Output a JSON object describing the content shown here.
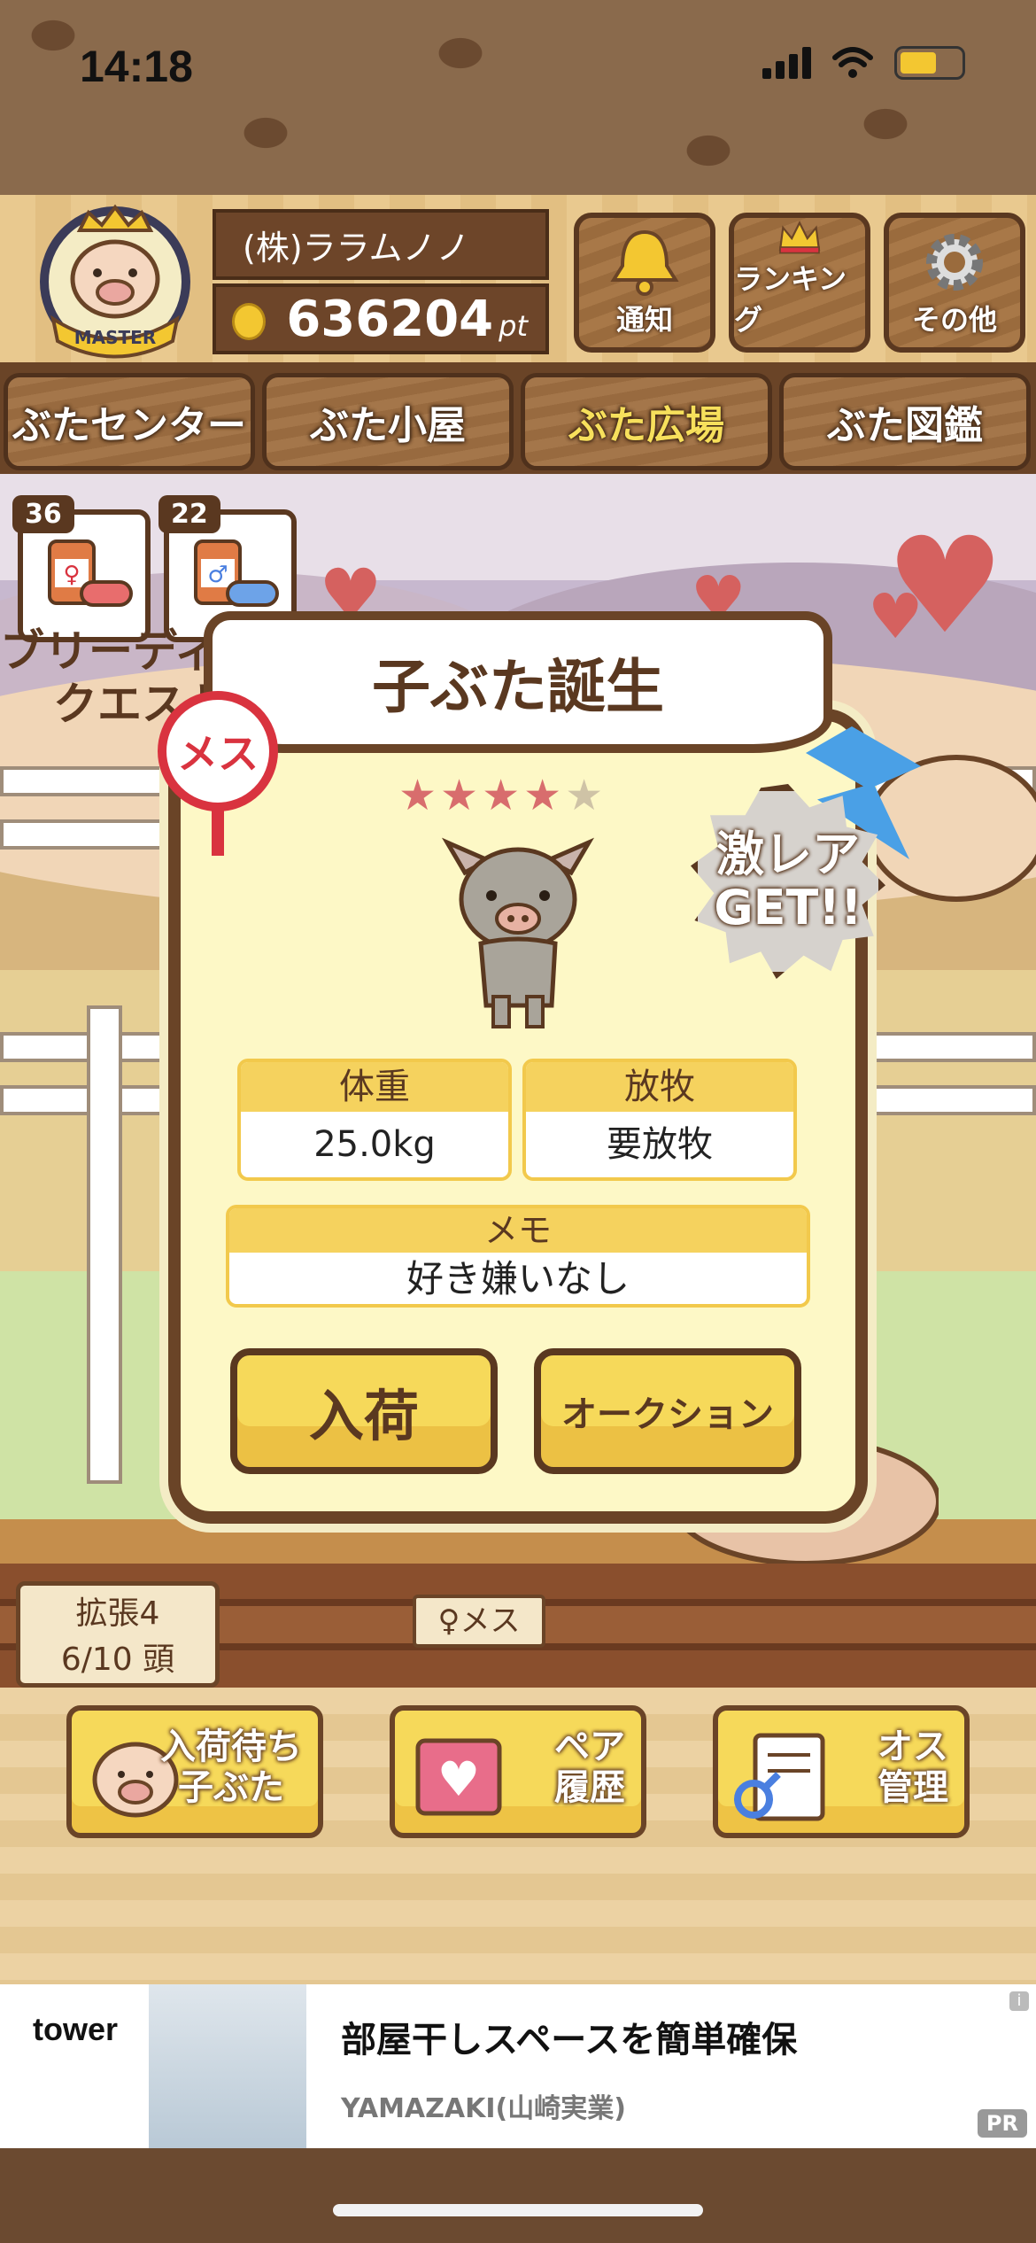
{
  "status": {
    "time": "14:18"
  },
  "header": {
    "company": "(株)ララムノノ",
    "points": "636204",
    "points_unit": "pt",
    "badge_text": "MASTER",
    "buttons": [
      {
        "label": "通知",
        "icon": "bell-icon"
      },
      {
        "label": "ランキング",
        "icon": "crown-icon"
      },
      {
        "label": "その他",
        "icon": "gear-icon"
      }
    ]
  },
  "nav": {
    "tabs": [
      {
        "label": "ぶたセンター",
        "active": false
      },
      {
        "label": "ぶた小屋",
        "active": false
      },
      {
        "label": "ぶた広場",
        "active": true
      },
      {
        "label": "ぶた図鑑",
        "active": false
      }
    ]
  },
  "field": {
    "items": [
      {
        "count": "36",
        "icon": "female-medicine-icon"
      },
      {
        "count": "22",
        "icon": "male-medicine-icon"
      }
    ],
    "quest_text_1": "ブリーディング",
    "quest_text_2": "クエスト",
    "expand_label": "拡張4",
    "expand_count": "6/10 頭",
    "pen_sign": "♀メス"
  },
  "modal": {
    "title": "子ぶた誕生",
    "gender": "メス",
    "stars_filled": 4,
    "stars_total": 5,
    "rare_line1": "激レア",
    "rare_line2": "GET!!",
    "weight_label": "体重",
    "weight_value": "25.0kg",
    "graze_label": "放牧",
    "graze_value": "要放牧",
    "memo_label": "メモ",
    "memo_value": "好き嫌いなし",
    "accept_label": "入荷",
    "auction_label": "オークション"
  },
  "bottom": {
    "buttons": [
      {
        "line1": "入荷待ち",
        "line2": "子ぶた",
        "icon": "piglet-icon"
      },
      {
        "line1": "ペア",
        "line2": "履歴",
        "icon": "heart-book-icon"
      },
      {
        "line1": "オス",
        "line2": "管理",
        "icon": "male-document-icon"
      }
    ]
  },
  "ad": {
    "brand": "tower",
    "title": "部屋干しスペースを簡単確保",
    "advertiser": "YAMAZAKI(山崎実業)",
    "pr": "PR",
    "info": "i"
  },
  "colors": {
    "accent_yellow": "#f6d95a",
    "wood_brown": "#6a4427",
    "female_red": "#d9333f",
    "male_blue": "#4aa0e6"
  }
}
